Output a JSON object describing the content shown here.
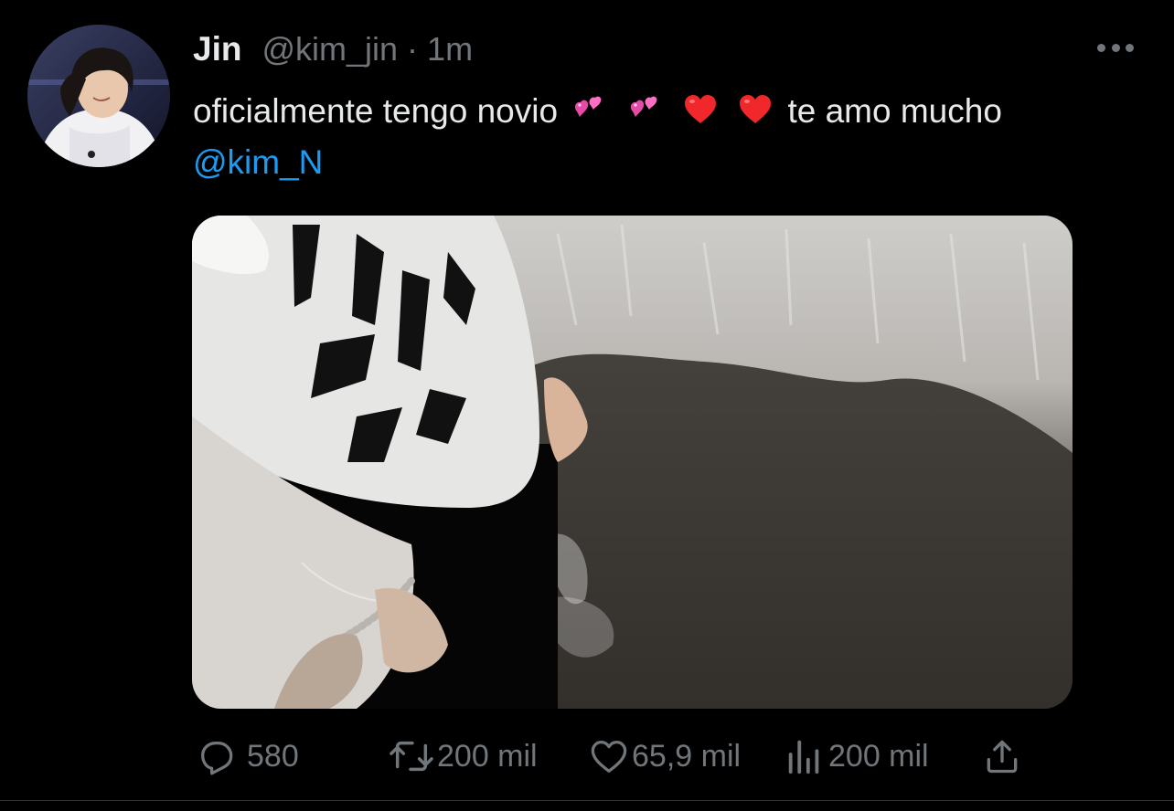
{
  "tweet": {
    "author": {
      "display_name": "Jin",
      "handle": "@kim_jin",
      "avatar_icon": "avatar-photo"
    },
    "separator": "·",
    "timestamp": "1m",
    "more_icon": "more-horizontal-icon",
    "text_before": "oficialmente tengo novio",
    "emojis": [
      "two-hearts",
      "two-hearts",
      "red-heart",
      "red-heart"
    ],
    "text_after": "te amo mucho",
    "mention": "@kim_N",
    "media": {
      "type": "photo"
    }
  },
  "actions": {
    "reply": {
      "icon": "reply-icon",
      "count": "580"
    },
    "retweet": {
      "icon": "retweet-icon",
      "count": "200 mil"
    },
    "like": {
      "icon": "heart-icon",
      "count": "65,9 mil"
    },
    "views": {
      "icon": "views-icon",
      "count": "200 mil"
    },
    "share": {
      "icon": "share-icon"
    }
  },
  "colors": {
    "background": "#000000",
    "primary_text": "#e7e9ea",
    "secondary_text": "#71767b",
    "link": "#1d9bf0"
  }
}
